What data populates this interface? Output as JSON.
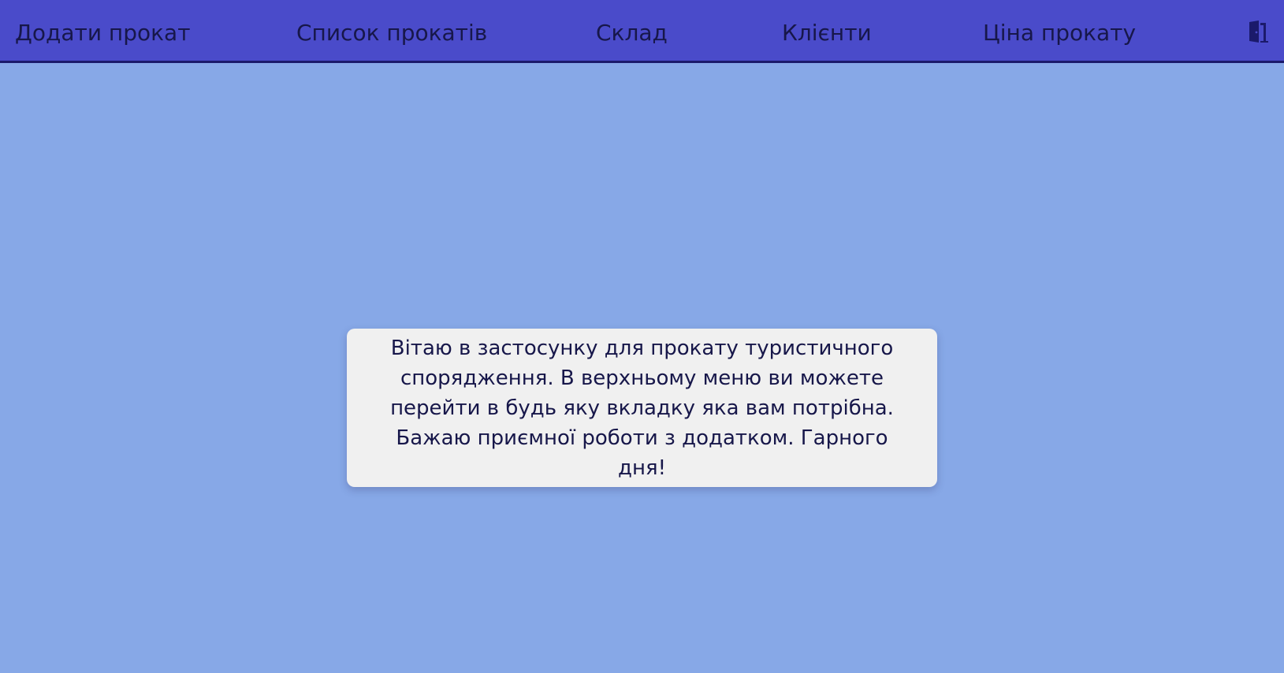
{
  "nav": {
    "items": [
      {
        "label": "Додати прокат"
      },
      {
        "label": "Список прокатів"
      },
      {
        "label": "Склад"
      },
      {
        "label": "Клієнти"
      },
      {
        "label": "Ціна прокату"
      }
    ],
    "logout_icon": "door-exit-icon"
  },
  "welcome": {
    "lines": [
      "Вітаю в застосунку для прокату туристичного",
      "спорядження. В верхньому меню ви можете",
      "перейти в будь яку вкладку яка вам потрібна.",
      "Бажаю приємної роботи з додатком. Гарного дня!"
    ]
  },
  "colors": {
    "background": "#87a8e7",
    "topbar": "#4a4bca",
    "topbar_border": "#1b1a6b",
    "card": "#f0f0f0",
    "text": "#17174a"
  }
}
